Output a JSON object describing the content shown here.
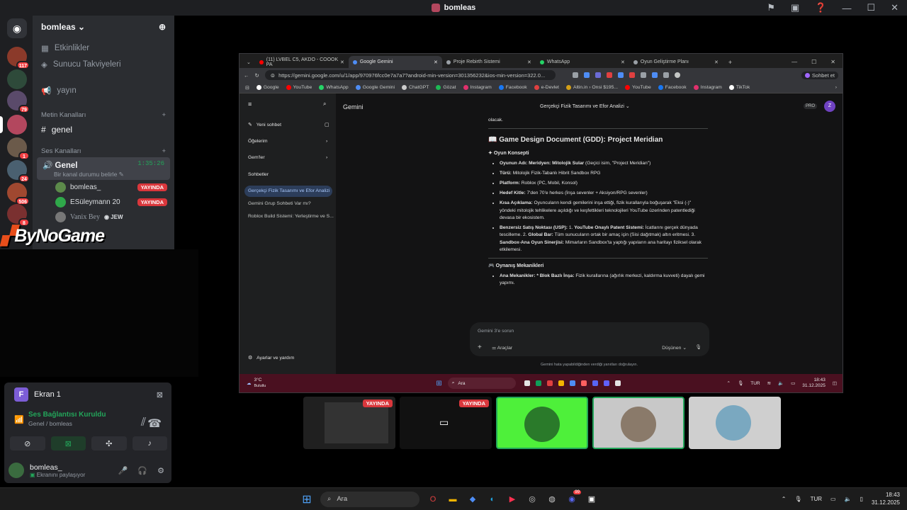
{
  "titlebar": {
    "title": "bomleas"
  },
  "guild_badges": [
    "117",
    "79",
    "1",
    "24",
    "506",
    "8"
  ],
  "server": {
    "name": "bomleas",
    "etkinlikler": "Etkinlikler",
    "takviye": "Sunucu Takviyeleri",
    "yayin": "yayın",
    "text_cat": "Metin Kanalları",
    "text_channel": "genel",
    "voice_cat": "Ses Kanalları",
    "voice_channel": "Genel",
    "voice_timer": "1:35:26",
    "voice_status": "Bir kanal durumu belirle",
    "users": [
      {
        "name": "bomleas_",
        "live": "YAYINDA"
      },
      {
        "name": "ESüleymann 20",
        "live": "YAYINDA"
      },
      {
        "name": "Vanix Bey",
        "tag": "JEW"
      }
    ]
  },
  "logo": "ByNoGame",
  "panel": {
    "screen_title": "Ekran 1",
    "screen_letter": "F",
    "conn_title": "Ses Bağlantısı Kuruldu",
    "conn_sub": "Genel / bomleas",
    "username": "bomleas_",
    "userstatus": "Ekranını paylaşıyor"
  },
  "browser": {
    "tabs": [
      "(11) LVBEL C5, AKDO - COOOK PA",
      "Google Gemini",
      "Proje Rebirth Sistemi",
      "WhatsApp",
      "Oyun Geliştirme Planı"
    ],
    "url": "https://gemini.google.com/u/1/app/970976fcc0e7a7a7?android-min-version=301356232&ios-min-version=322.0...",
    "sohbet": "Sohbet et",
    "bookmarks": [
      "Google",
      "YouTube",
      "WhatsApp",
      "Google Gemini",
      "ChatGPT",
      "Gözat",
      "Instagram",
      "Facebook",
      "e-Devlet",
      "Altin.in › Onsi $195...",
      "YouTube",
      "Facebook",
      "Instagram",
      "TikTok"
    ]
  },
  "gemini": {
    "app": "Gemini",
    "chat_title": "Gerçekçi Fizik Tasarımı ve Efor Analizi",
    "pro": "PRO",
    "avatar": "Z",
    "new_chat": "Yeni sohbet",
    "items": "Öğelerim",
    "gems": "Gem'ler",
    "chats": "Sohbetler",
    "chat_list": [
      "Gerçekçi Fizik Tasarımı ve Efor Analizi",
      "Gemini Grup Sohbeti Var mı?",
      "Roblox Build Sistemi: Yerleştirme ve S..."
    ],
    "settings": "Ayarlar ve yardım",
    "top_text": "olacak.",
    "heading": "Game Design Document (GDD): Project Meridian",
    "section1": "Oyun Konsepti",
    "bullets": [
      {
        "b": "Oyunun Adı: Meridyen: Mitolojik Sular",
        "t": " (Geçici isim, \"Project Meridian\")"
      },
      {
        "b": "Türü:",
        "t": " Mitolojik Fizik-Tabanlı Hibrit Sandbox RPG"
      },
      {
        "b": "Platform:",
        "t": " Roblox (PC, Mobil, Konsol)"
      },
      {
        "b": "Hedef Kitle:",
        "t": " 7'den 70'e herkes (İnşa sevenler + Aksiyon/RPG sevenler)"
      },
      {
        "b": "Kısa Açıklama:",
        "t": " Oyuncuların kendi gemilerini inşa ettiği, fizik kurallarıyla boğuşarak \"Eksi (-)\" yöndeki mitolojik tehlikelere açıldığı ve keşfettikleri teknolojileri YouTube üzerinden patentlediği devasa bir ekosistem."
      }
    ],
    "usp_b1": "Benzersiz Satış Noktası (USP):",
    "usp_t1": " 1. ",
    "usp_b2": "YouTube Onaylı Patent Sistemi:",
    "usp_t2": " İcatlarını gerçek dünyada tescilleme. 2. ",
    "usp_b3": "Global Bar:",
    "usp_t3": " Tüm sunucuların ortak bir amaç için (Sisi dağıtmak) altın eritmesi. 3. ",
    "usp_b4": "Sandbox-Ana Oyun Sinerjisi:",
    "usp_t4": " Mimarların Sandbox'ta yaptığı yapıların ana haritayı fiziksel olarak etkilemesi.",
    "section2": "Oynanış Mekanikleri",
    "mech_b": "Ana Mekanikler: * Blok Bazlı İnşa:",
    "mech_t": " Fizik kurallarına (ağırlık merkezi, kaldırma kuvveti) dayalı gemi yapımı.",
    "input_placeholder": "Gemini 3'e sorun",
    "tools": "Araçlar",
    "mode": "Düşünen",
    "disclaimer": "Gemini hata yapabildiğinden verdiği yanıtları doğrulayın."
  },
  "stream_taskbar": {
    "weather": "3°C",
    "weather_sub": "Bulutlu",
    "search": "Ara",
    "lang": "TUR",
    "time": "18:43",
    "date": "31.12.2025"
  },
  "thumbs": [
    {
      "live": "YAYINDA"
    },
    {
      "live": "YAYINDA"
    },
    {},
    {},
    {}
  ],
  "taskbar": {
    "search": "Ara",
    "lang": "TUR",
    "time": "18:43",
    "date": "31.12.2025",
    "discord_badge": "99"
  }
}
